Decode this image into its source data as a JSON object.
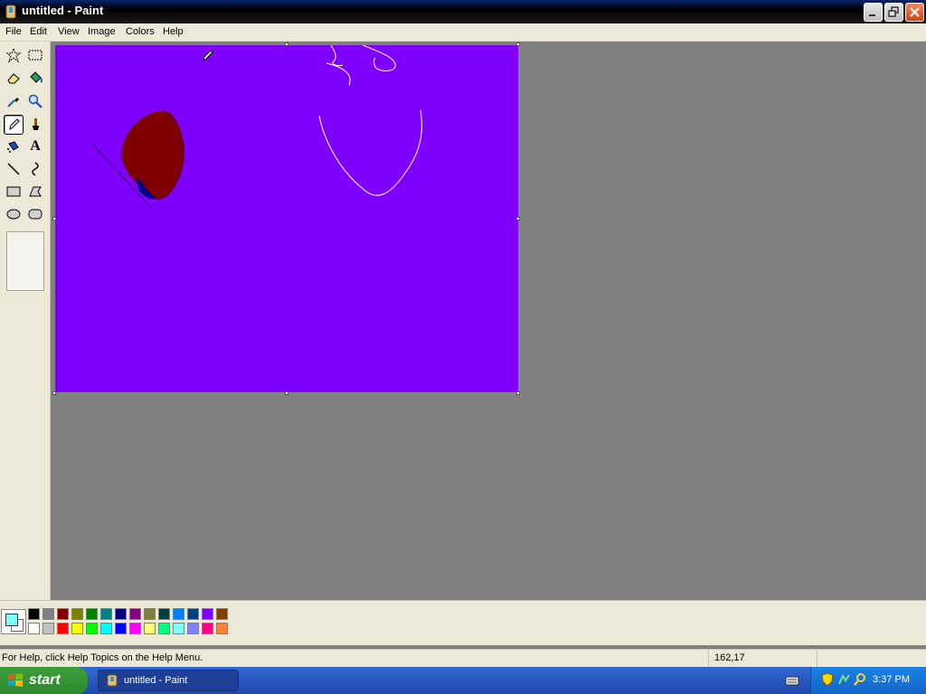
{
  "window": {
    "title": "untitled - Paint"
  },
  "menubar": {
    "items": [
      "File",
      "Edit",
      "View",
      "Image",
      "Colors",
      "Help"
    ]
  },
  "toolbox": {
    "tools": [
      {
        "name": "free-form-select",
        "icon": "star-select-icon"
      },
      {
        "name": "select",
        "icon": "rect-select-icon"
      },
      {
        "name": "eraser",
        "icon": "eraser-icon"
      },
      {
        "name": "fill-with-color",
        "icon": "paint-bucket-icon"
      },
      {
        "name": "pick-color",
        "icon": "eyedropper-icon"
      },
      {
        "name": "magnifier",
        "icon": "magnifier-icon"
      },
      {
        "name": "pencil",
        "icon": "pencil-icon",
        "selected": true
      },
      {
        "name": "brush",
        "icon": "brush-icon"
      },
      {
        "name": "airbrush",
        "icon": "airbrush-icon"
      },
      {
        "name": "text",
        "icon": "text-a-icon",
        "label": "A"
      },
      {
        "name": "line",
        "icon": "line-icon"
      },
      {
        "name": "curve",
        "icon": "curve-icon"
      },
      {
        "name": "rectangle",
        "icon": "rectangle-icon"
      },
      {
        "name": "polygon",
        "icon": "polygon-icon"
      },
      {
        "name": "ellipse",
        "icon": "ellipse-icon"
      },
      {
        "name": "rounded-rectangle",
        "icon": "rounded-rect-icon"
      }
    ]
  },
  "canvas": {
    "background": "#7f00ff"
  },
  "palette": {
    "foreground": "#80ffff",
    "background": "#ffffff",
    "row1": [
      "#000000",
      "#808080",
      "#800000",
      "#808000",
      "#008000",
      "#008080",
      "#000080",
      "#800080",
      "#808040",
      "#004040",
      "#0080ff",
      "#004080",
      "#8000ff",
      "#804000"
    ],
    "row2": [
      "#ffffff",
      "#c0c0c0",
      "#ff0000",
      "#ffff00",
      "#00ff00",
      "#00ffff",
      "#0000ff",
      "#ff00ff",
      "#ffff80",
      "#00ff80",
      "#80ffff",
      "#8080ff",
      "#ff0080",
      "#ff8040"
    ]
  },
  "statusbar": {
    "help_text": "For Help, click Help Topics on the Help Menu.",
    "coords": "162,17"
  },
  "taskbar": {
    "start_label": "start",
    "task_label": "untitled - Paint",
    "clock": "3:37 PM"
  }
}
